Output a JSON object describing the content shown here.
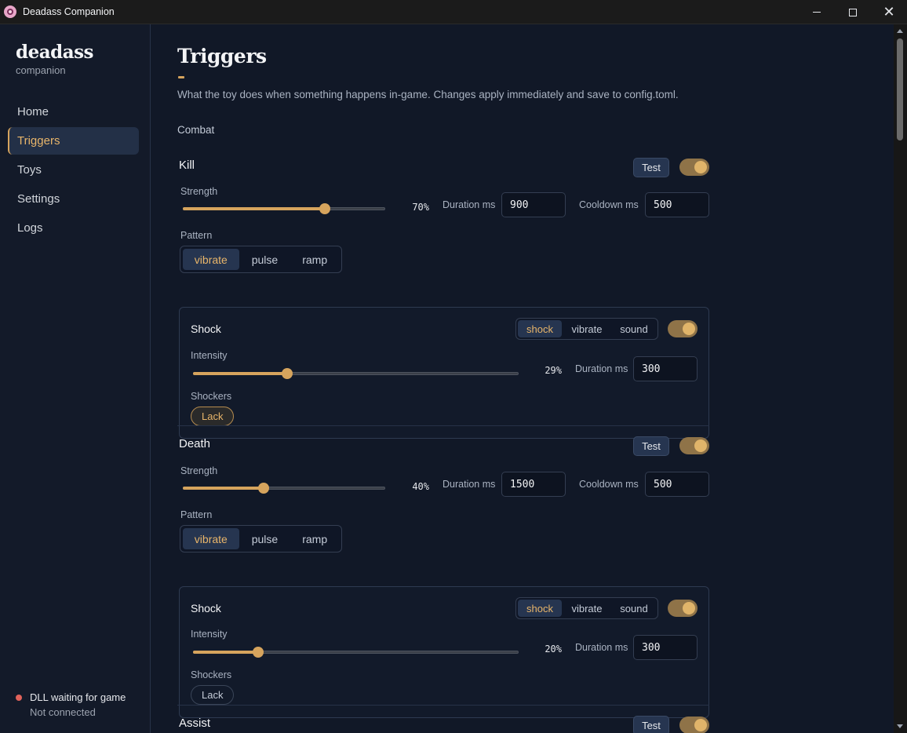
{
  "window": {
    "title": "Deadass Companion"
  },
  "brand": {
    "name": "deadass",
    "subtitle": "companion"
  },
  "nav": [
    {
      "label": "Home",
      "active": false
    },
    {
      "label": "Triggers",
      "active": true
    },
    {
      "label": "Toys",
      "active": false
    },
    {
      "label": "Settings",
      "active": false
    },
    {
      "label": "Logs",
      "active": false
    }
  ],
  "status": {
    "main": "DLL waiting for game",
    "sub": "Not connected",
    "dot_color": "#e0625a"
  },
  "page": {
    "title": "Triggers",
    "description": "What the toy does when something happens in-game. Changes apply immediately and save to config.toml.",
    "section": "Combat"
  },
  "labels": {
    "test": "Test",
    "strength": "Strength",
    "duration": "Duration ms",
    "cooldown": "Cooldown ms",
    "pattern": "Pattern",
    "shock": "Shock",
    "intensity": "Intensity",
    "shockers": "Shockers"
  },
  "pattern_options": [
    "vibrate",
    "pulse",
    "ramp"
  ],
  "shock_modes": [
    "shock",
    "vibrate",
    "sound"
  ],
  "triggers": [
    {
      "name": "Kill",
      "enabled": true,
      "strength": 70,
      "strength_label": "70%",
      "duration_ms": "900",
      "cooldown_ms": "500",
      "pattern": "vibrate",
      "shock": {
        "enabled": true,
        "mode": "shock",
        "intensity": 29,
        "intensity_label": "29%",
        "duration_ms": "300",
        "shockers": [
          {
            "name": "Lack",
            "selected": true
          }
        ]
      }
    },
    {
      "name": "Death",
      "enabled": true,
      "strength": 40,
      "strength_label": "40%",
      "duration_ms": "1500",
      "cooldown_ms": "500",
      "pattern": "vibrate",
      "shock": {
        "enabled": true,
        "mode": "shock",
        "intensity": 20,
        "intensity_label": "20%",
        "duration_ms": "300",
        "shockers": [
          {
            "name": "Lack",
            "selected": false
          }
        ]
      }
    },
    {
      "name": "Assist",
      "enabled": true
    }
  ],
  "colors": {
    "accent": "#d6a45d",
    "background": "#111827",
    "sidebar": "#131a29"
  }
}
